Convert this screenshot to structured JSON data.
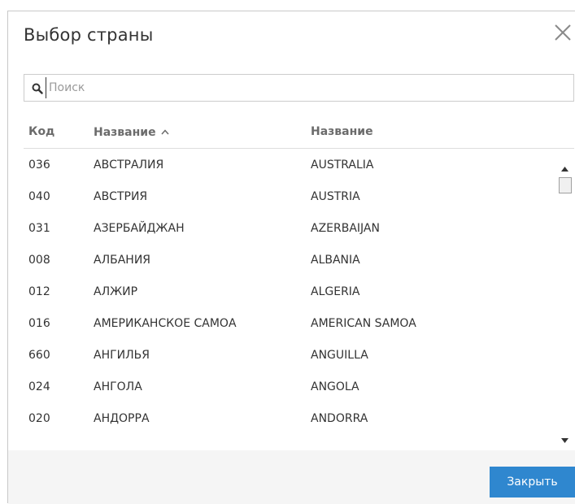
{
  "dialog": {
    "title": "Выбор страны",
    "close_icon": "close-icon"
  },
  "search": {
    "icon": "search-icon",
    "placeholder": "Поиск",
    "value": ""
  },
  "table": {
    "columns": [
      {
        "label": "Код"
      },
      {
        "label": "Название",
        "sort": "ascending",
        "sort_icon": "chevron-up-icon"
      },
      {
        "label": "Название"
      }
    ],
    "rows": [
      {
        "code": "036",
        "name_ru": "АВСТРАЛИЯ",
        "name_en": "AUSTRALIA"
      },
      {
        "code": "040",
        "name_ru": "АВСТРИЯ",
        "name_en": "AUSTRIA"
      },
      {
        "code": "031",
        "name_ru": "АЗЕРБАЙДЖАН",
        "name_en": "AZERBAIJAN"
      },
      {
        "code": "008",
        "name_ru": "АЛБАНИЯ",
        "name_en": "ALBANIA"
      },
      {
        "code": "012",
        "name_ru": "АЛЖИР",
        "name_en": "ALGERIA"
      },
      {
        "code": "016",
        "name_ru": "АМЕРИКАНСКОЕ САМОА",
        "name_en": "AMERICAN SAMOA"
      },
      {
        "code": "660",
        "name_ru": "АНГИЛЬЯ",
        "name_en": "ANGUILLA"
      },
      {
        "code": "024",
        "name_ru": "АНГОЛА",
        "name_en": "ANGOLA"
      },
      {
        "code": "020",
        "name_ru": "АНДОРРА",
        "name_en": "ANDORRA"
      }
    ]
  },
  "footer": {
    "close_label": "Закрыть"
  },
  "colors": {
    "primary_button": "#2f87cf",
    "footer_background": "#f5f5f5",
    "header_text": "#6b6b6b"
  }
}
